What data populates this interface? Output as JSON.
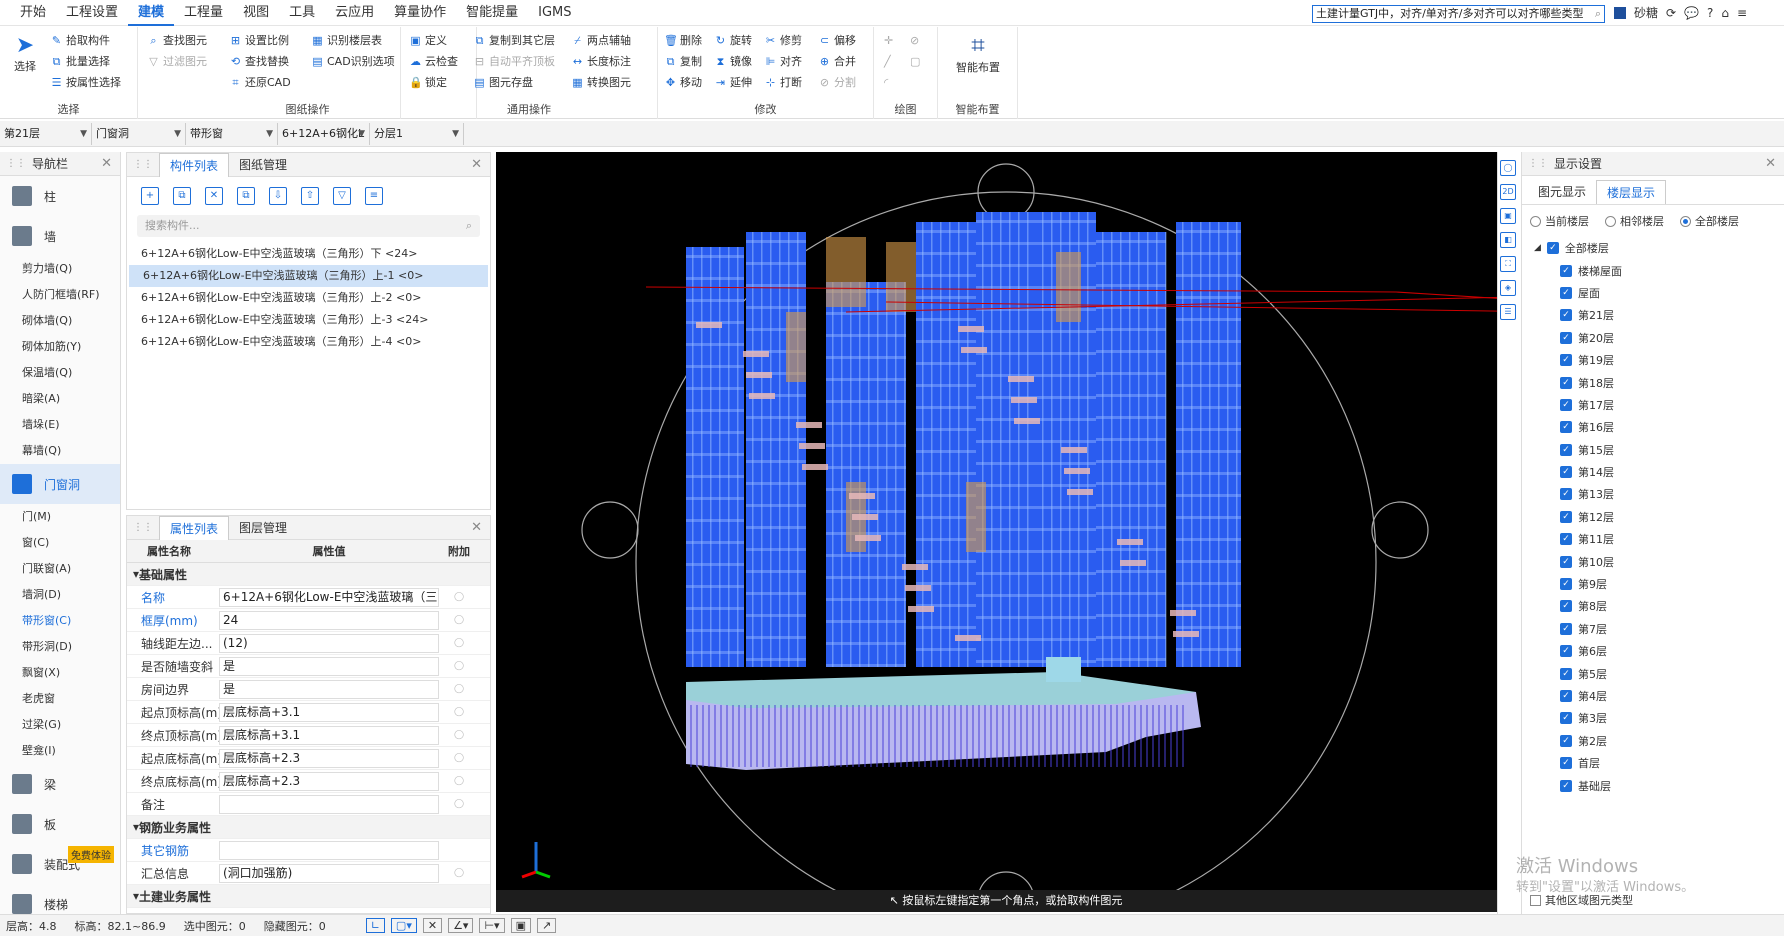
{
  "menu": [
    "开始",
    "工程设置",
    "建模",
    "工程量",
    "视图",
    "工具",
    "云应用",
    "算量协作",
    "智能提量",
    "IGMS"
  ],
  "menu_active": 2,
  "top_search": "土建计量GTJ中，对齐/单对齐/多对齐可以对齐哪些类型",
  "user": "砂糖",
  "ribbon": {
    "select_group": {
      "big_label": "选择",
      "items": [
        "拾取构件",
        "批量选择",
        "按属性选择"
      ],
      "title": "选择"
    },
    "drawing_ops": {
      "items": [
        "查找图元",
        "过滤图元",
        "设置比例",
        "查找替换",
        "还原CAD",
        "识别楼层表",
        "CAD识别选项"
      ],
      "title": "图纸操作"
    },
    "general_ops": {
      "items": [
        "定义",
        "云检查",
        "锁定",
        "复制到其它层",
        "自动平齐顶板",
        "图元存盘",
        "两点辅轴",
        "长度标注",
        "转换图元"
      ],
      "title": "通用操作"
    },
    "modify": {
      "items": [
        "删除",
        "复制",
        "移动",
        "旋转",
        "镜像",
        "延伸",
        "修剪",
        "对齐",
        "打断",
        "偏移",
        "合并",
        "分割"
      ],
      "title": "修改"
    },
    "draw": {
      "title": "绘图"
    },
    "smart": {
      "big_label": "智能布置",
      "title": "智能布置"
    }
  },
  "toolbar2": {
    "floor": "第21层",
    "type": "门窗洞",
    "subtype": "带形窗",
    "component": "6+12A+6钢化L",
    "layer": "分层1"
  },
  "nav": {
    "title": "导航栏",
    "items_top": [
      {
        "label": "柱"
      },
      {
        "label": "墙"
      }
    ],
    "wall_items": [
      "剪力墙(Q)",
      "人防门框墙(RF)",
      "砌体墙(Q)",
      "砌体加筋(Y)",
      "保温墙(Q)",
      "暗梁(A)",
      "墙垛(E)",
      "幕墙(Q)"
    ],
    "active_group": "门窗洞",
    "door_items": [
      "门(M)",
      "窗(C)",
      "门联窗(A)",
      "墙洞(D)",
      "带形窗(C)",
      "带形洞(D)",
      "飘窗(X)",
      "老虎窗",
      "过梁(G)",
      "壁龛(I)"
    ],
    "door_active": 4,
    "items_bottom": [
      {
        "label": "梁"
      },
      {
        "label": "板"
      },
      {
        "label": "装配式"
      },
      {
        "label": "楼梯"
      }
    ],
    "badge": "免费体验"
  },
  "complist": {
    "tabs": [
      "构件列表",
      "图纸管理"
    ],
    "search_placeholder": "搜索构件...",
    "items": [
      "6+12A+6钢化Low-E中空浅蓝玻璃（三角形）下 <24>",
      "6+12A+6钢化Low-E中空浅蓝玻璃（三角形）上-1 <0>",
      "6+12A+6钢化Low-E中空浅蓝玻璃（三角形）上-2 <0>",
      "6+12A+6钢化Low-E中空浅蓝玻璃（三角形）上-3 <24>",
      "6+12A+6钢化Low-E中空浅蓝玻璃（三角形）上-4 <0>"
    ],
    "selected": 1
  },
  "props": {
    "tabs": [
      "属性列表",
      "图层管理"
    ],
    "headers": [
      "属性名称",
      "属性值",
      "附加"
    ],
    "sections": [
      "基础属性",
      "钢筋业务属性",
      "土建业务属性"
    ],
    "rows": [
      {
        "name": "名称",
        "value": "6+12A+6钢化Low-E中空浅蓝玻璃（三...",
        "blue": true
      },
      {
        "name": "框厚(mm)",
        "value": "24",
        "blue": true
      },
      {
        "name": "轴线距左边...",
        "value": "(12)",
        "blue": false
      },
      {
        "name": "是否随墙变斜",
        "value": "是",
        "blue": false
      },
      {
        "name": "房间边界",
        "value": "是",
        "blue": false
      },
      {
        "name": "起点顶标高(m)",
        "value": "层底标高+3.1",
        "blue": false
      },
      {
        "name": "终点顶标高(m)",
        "value": "层底标高+3.1",
        "blue": false
      },
      {
        "name": "起点底标高(m)",
        "value": "层底标高+2.3",
        "blue": false
      },
      {
        "name": "终点底标高(m)",
        "value": "层底标高+2.3",
        "blue": false
      },
      {
        "name": "备注",
        "value": "",
        "blue": false
      }
    ],
    "rebar_rows": [
      {
        "name": "其它钢筋",
        "value": "",
        "blue": true
      },
      {
        "name": "汇总信息",
        "value": "(洞口加强筋)",
        "blue": false
      }
    ]
  },
  "viewport": {
    "hint": "按鼠标左键指定第一个角点，或拾取构件图元"
  },
  "display": {
    "title": "显示设置",
    "tabs": [
      "图元显示",
      "楼层显示"
    ],
    "radios": [
      "当前楼层",
      "相邻楼层",
      "全部楼层"
    ],
    "radio_selected": 2,
    "root": "全部楼层",
    "floors": [
      "楼梯屋面",
      "屋面",
      "第21层",
      "第20层",
      "第19层",
      "第18层",
      "第17层",
      "第16层",
      "第15层",
      "第14层",
      "第13层",
      "第12层",
      "第11层",
      "第10层",
      "第9层",
      "第8层",
      "第7层",
      "第6层",
      "第5层",
      "第4层",
      "第3层",
      "第2层",
      "首层",
      "基础层"
    ],
    "other_area": "其他区域图元类型"
  },
  "status": {
    "floor_height": "层高：4.8",
    "elevation": "标高：82.1~86.9",
    "selected": "选中图元：0",
    "hidden": "隐藏图元：0"
  },
  "activate": {
    "line1": "激活 Windows",
    "line2": "转到\"设置\"以激活 Windows。"
  },
  "colors": {
    "accent": "#1e6fd9",
    "facade": "#2a5cf0",
    "glass": "#3a7bd5",
    "bg": "#000000"
  }
}
